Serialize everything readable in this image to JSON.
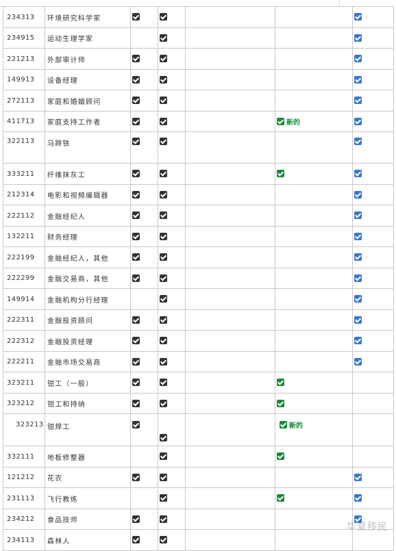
{
  "new_label": "新的",
  "colors": {
    "dark_check": "#333333",
    "green_check": "#1a8a3a",
    "blue_check": "#3a78c8"
  },
  "rows": [
    {
      "code": "234313",
      "name": "环境研究科学家",
      "c1": true,
      "c2": true,
      "c4": false,
      "new": false,
      "c5": true
    },
    {
      "code": "234915",
      "name": "运动生理学家",
      "c1": false,
      "c2": true,
      "c4": false,
      "new": false,
      "c5": true
    },
    {
      "code": "221213",
      "name": "外部审计师",
      "c1": true,
      "c2": true,
      "c4": false,
      "new": false,
      "c5": true
    },
    {
      "code": "149913",
      "name": "设备经理",
      "c1": true,
      "c2": true,
      "c4": false,
      "new": false,
      "c5": true
    },
    {
      "code": "272113",
      "name": "家庭和婚姻顾问",
      "c1": true,
      "c2": true,
      "c4": false,
      "new": false,
      "c5": true
    },
    {
      "code": "411713",
      "name": "家庭支持工作者",
      "c1": true,
      "c2": true,
      "c4": true,
      "new": true,
      "c5": true
    },
    {
      "code": "322113",
      "name": "马蹄铁",
      "c1": true,
      "c2": true,
      "c4": false,
      "new": false,
      "c5": true
    },
    {
      "code": "333211",
      "name": "纤维抹灰工",
      "c1": true,
      "c2": true,
      "c4": true,
      "new": false,
      "c5": true
    },
    {
      "code": "212314",
      "name": "电影和视频编辑器",
      "c1": true,
      "c2": true,
      "c4": false,
      "new": false,
      "c5": true
    },
    {
      "code": "222112",
      "name": "金融经纪人",
      "c1": true,
      "c2": true,
      "c4": false,
      "new": false,
      "c5": true
    },
    {
      "code": "132211",
      "name": "财务经理",
      "c1": true,
      "c2": true,
      "c4": false,
      "new": false,
      "c5": true
    },
    {
      "code": "222199",
      "name": "金融经纪人，其他",
      "c1": true,
      "c2": true,
      "c4": false,
      "new": false,
      "c5": true
    },
    {
      "code": "222299",
      "name": "金融交易商，其他",
      "c1": true,
      "c2": true,
      "c4": false,
      "new": false,
      "c5": true
    },
    {
      "code": "149914",
      "name": "金融机构分行经理",
      "c1": false,
      "c2": true,
      "c4": false,
      "new": false,
      "c5": true
    },
    {
      "code": "222311",
      "name": "金融投资顾问",
      "c1": true,
      "c2": true,
      "c4": false,
      "new": false,
      "c5": true
    },
    {
      "code": "222312",
      "name": "金融投资经理",
      "c1": true,
      "c2": true,
      "c4": false,
      "new": false,
      "c5": true
    },
    {
      "code": "222211",
      "name": "金融市场交易商",
      "c1": true,
      "c2": true,
      "c4": false,
      "new": false,
      "c5": true
    },
    {
      "code": "323211",
      "name": "钳工（一般）",
      "c1": true,
      "c2": true,
      "c4": true,
      "new": false,
      "c5": false
    },
    {
      "code": "323212",
      "name": "钳工和持纳",
      "c1": true,
      "c2": true,
      "c4": true,
      "new": false,
      "c5": false
    },
    {
      "code": "323213",
      "name": "钳焊工",
      "c1": true,
      "c2": true,
      "c4": true,
      "new": true,
      "c5": false
    },
    {
      "code": "332111",
      "name": "地板修整器",
      "c1": false,
      "c2": true,
      "c4": true,
      "new": false,
      "c5": false
    },
    {
      "code": "121212",
      "name": "花农",
      "c1": true,
      "c2": true,
      "c4": false,
      "new": false,
      "c5": true
    },
    {
      "code": "231113",
      "name": "飞行教练",
      "c1": false,
      "c2": true,
      "c4": true,
      "new": false,
      "c5": true
    },
    {
      "code": "234212",
      "name": "食品技师",
      "c1": true,
      "c2": true,
      "c4": false,
      "new": false,
      "c5": true
    },
    {
      "code": "234113",
      "name": "森林人",
      "c1": true,
      "c2": true,
      "c4": false,
      "new": false,
      "c5": false
    }
  ]
}
